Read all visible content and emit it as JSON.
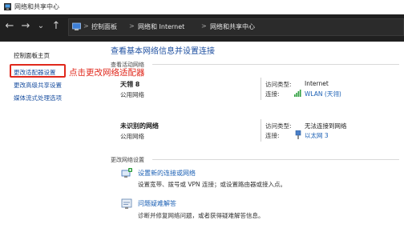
{
  "window": {
    "title": "网络和共享中心"
  },
  "breadcrumb": {
    "items": [
      "控制面板",
      "网络和 Internet",
      "网络和共享中心"
    ],
    "separator": ">"
  },
  "nav": {
    "back": "←",
    "forward": "→",
    "down": "⌄",
    "up": "↑"
  },
  "sidebar": {
    "items": [
      {
        "label": "控制面板主页"
      },
      {
        "label": "更改适配器设置"
      },
      {
        "label": "更改高级共享设置"
      },
      {
        "label": "媒体流式处理选项"
      }
    ]
  },
  "annotation": {
    "text": "点击更改网络适配器",
    "color": "#e0281c"
  },
  "main": {
    "title": "查看基本网络信息并设置连接",
    "active_networks_label": "查看活动网络",
    "networks": [
      {
        "name": "天翎 8",
        "type": "公用网络",
        "access_label": "访问类型:",
        "access_value": "Internet",
        "conn_label": "连接:",
        "conn_value": "WLAN (天翎)"
      },
      {
        "name": "未识别的网络",
        "type": "公用网络",
        "access_label": "访问类型:",
        "access_value": "无法连接到网络",
        "conn_label": "连接:",
        "conn_value": "以太网 3"
      }
    ],
    "change_settings_label": "更改网络设置",
    "tasks": [
      {
        "link": "设置新的连接或网络",
        "desc": "设置宽带、拨号或 VPN 连接；或设置路由器或接入点。",
        "icon": "new-connection-icon"
      },
      {
        "link": "问题疑难解答",
        "desc": "诊断并修复网络问题，或者获得疑难解答信息。",
        "icon": "troubleshoot-icon"
      }
    ]
  },
  "colors": {
    "link": "#1a5fb4",
    "header_bg": "#202020",
    "annotation": "#e0281c"
  }
}
